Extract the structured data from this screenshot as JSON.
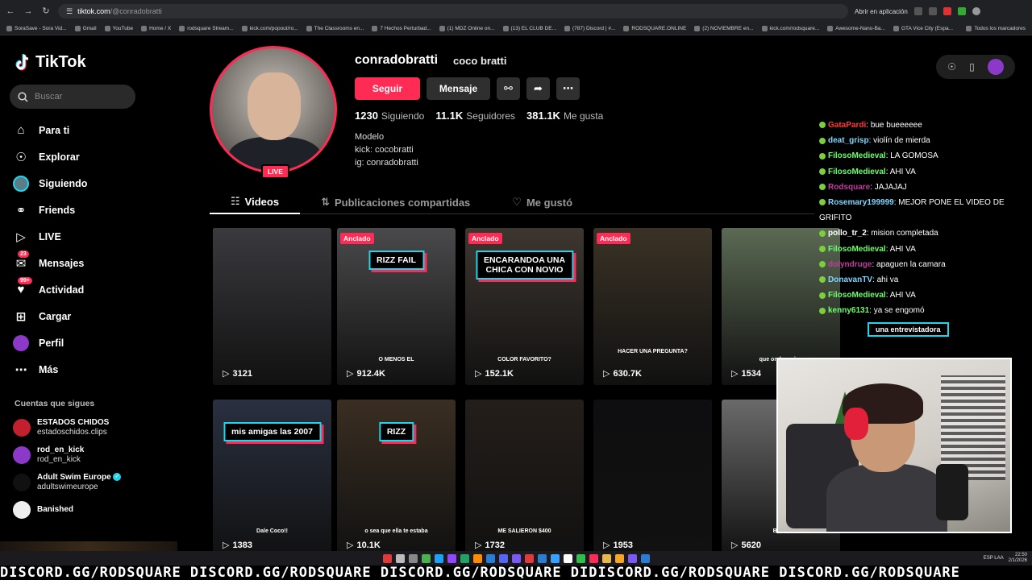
{
  "browser": {
    "url_host": "tiktok.com",
    "url_path": "/@conradobratti",
    "app_open_label": "Abrir en aplicación",
    "bookmarks": [
      "SoraSave - Sora Vid...",
      "Gmail",
      "YouTube",
      "Home / X",
      "rodsquare Stream...",
      "kick.com/popout/ro...",
      "The Classrooms en...",
      "7 Hechos Perturbad...",
      "(1) MDZ Online on...",
      "(13) EL CLUB DE...",
      "(787) Discord | #...",
      "RODSQUARE.ONLINE",
      "(2) NOVIEMBRE en...",
      "kick.com/rodsquare...",
      "Awesome-Nano-Ba...",
      "GTA Vice City (Espa..."
    ],
    "all_bookmarks": "Todos los marcadores"
  },
  "sidebar": {
    "logo": "TikTok",
    "search_placeholder": "Buscar",
    "items": [
      {
        "label": "Para ti",
        "icon": "home-icon"
      },
      {
        "label": "Explorar",
        "icon": "compass-icon"
      },
      {
        "label": "Siguiendo",
        "icon": "following-avatar-icon"
      },
      {
        "label": "Friends",
        "icon": "friends-icon"
      },
      {
        "label": "LIVE",
        "icon": "live-icon"
      },
      {
        "label": "Mensajes",
        "icon": "messages-icon",
        "badge": "23"
      },
      {
        "label": "Actividad",
        "icon": "activity-icon",
        "badge": "99+"
      },
      {
        "label": "Cargar",
        "icon": "upload-icon"
      },
      {
        "label": "Perfil",
        "icon": "profile-icon"
      },
      {
        "label": "Más",
        "icon": "more-icon"
      }
    ],
    "following_title": "Cuentas que sigues",
    "following": [
      {
        "name": "ESTADOS CHIDOS",
        "handle": "estadoschidos.clips",
        "color": "#c21f2f"
      },
      {
        "name": "rod_en_kick",
        "handle": "rod_en_kick",
        "color": "#8c39c9"
      },
      {
        "name": "Adult Swim Europe",
        "handle": "adultswimeurope",
        "color": "#111111",
        "verified": true
      },
      {
        "name": "Banished",
        "handle": "",
        "color": "#eeeeee"
      }
    ]
  },
  "profile": {
    "username": "conradobratti",
    "nickname": "coco bratti",
    "live_label": "LIVE",
    "follow_label": "Seguir",
    "message_label": "Mensaje",
    "stats": [
      {
        "value": "1230",
        "label": "Siguiendo"
      },
      {
        "value": "11.1K",
        "label": "Seguidores"
      },
      {
        "value": "381.1K",
        "label": "Me gusta"
      }
    ],
    "bio": [
      "Modelo",
      "kick: cocobratti",
      "ig: conradobratti"
    ]
  },
  "tabs": [
    {
      "label": "Videos",
      "icon": "grid-icon",
      "active": true
    },
    {
      "label": "Publicaciones compartidas",
      "icon": "repost-icon",
      "active": false
    },
    {
      "label": "Me gustó",
      "icon": "heart-icon",
      "active": false
    }
  ],
  "videos": [
    {
      "views": "",
      "badge": "LIVE",
      "caption": "",
      "sub": "",
      "bg": "#cbbfae"
    },
    {
      "views": "912.4K",
      "badge": "Anclado",
      "caption": "RIZZ FAIL",
      "sub": "O MENOS EL",
      "bg": "#4a4a4c"
    },
    {
      "views": "152.1K",
      "badge": "Anclado",
      "caption": "ENCARANDOA UNA\nCHICA CON NOVIO",
      "sub": "COLOR FAVORITO?",
      "bg": "#3e3630"
    },
    {
      "views": "630.7K",
      "badge": "Anclado",
      "caption": "",
      "sub": "HACER UNA PREGUNTA?",
      "bg": "#3a3226"
    },
    {
      "views": "1534",
      "badge": "",
      "caption": "",
      "sub": "que onda amigo",
      "bg": "#5b6a54"
    },
    {
      "views": "1383",
      "badge": "",
      "caption": "mis amigas las 2007",
      "sub": "Dale Coco!!",
      "bg": "#2a3040"
    },
    {
      "views": "10.1K",
      "badge": "",
      "caption": "RIZZ",
      "sub": "o sea que ella te estaba",
      "bg": "#3a2e22"
    },
    {
      "views": "1732",
      "badge": "",
      "caption": "",
      "sub": "ME SALIERON $400",
      "bg": "#241e1a"
    },
    {
      "views": "1953",
      "badge": "",
      "caption": "",
      "sub": "",
      "bg": "#0e0e10"
    },
    {
      "views": "5620",
      "badge": "",
      "caption": "",
      "sub": "BUEN",
      "bg": "#6a6a6a"
    },
    {
      "views": "3121",
      "badge": "",
      "caption": "",
      "sub": "",
      "bg": "#3a3a3e"
    }
  ],
  "chat": [
    {
      "user": "GataPardi",
      "msg": "bue bueeeeee",
      "color": "#ff3b3b"
    },
    {
      "user": "deat_grisp",
      "msg": "violín de mierda",
      "color": "#7fd6ff"
    },
    {
      "user": "FilosoMedieval",
      "msg": "LA GOMOSA",
      "color": "#6cff6c"
    },
    {
      "user": "FilosoMedieval",
      "msg": "AHI VA",
      "color": "#6cff6c"
    },
    {
      "user": "Rodsquare",
      "msg": "JAJAJAJ",
      "color": "#c23ba0"
    },
    {
      "user": "Rosemary199999",
      "msg": "MEJOR PONE EL VIDEO DE",
      "color": "#7fd6ff"
    },
    {
      "user": "",
      "msg": "GRIFITO",
      "color": "#ffffff"
    },
    {
      "user": "pollo_tr_2",
      "msg": "mision completada",
      "color": "#ffffff"
    },
    {
      "user": "FilosoMedieval",
      "msg": "AHI VA",
      "color": "#6cff6c"
    },
    {
      "user": "dolyndruge",
      "msg": "apaguen la camara",
      "color": "#c23ba0"
    },
    {
      "user": "DonavanTV",
      "msg": "ahi va",
      "color": "#7fd6ff"
    },
    {
      "user": "FilosoMedieval",
      "msg": "AHI VA",
      "color": "#6cff6c"
    },
    {
      "user": "kenny6131",
      "msg": "ya se engomó",
      "color": "#6cff6c"
    }
  ],
  "chat_bottom_caption": "una entrevistadora",
  "taskbar": {
    "lang": "ESP LAA",
    "time": "22:50",
    "date": "2/1/2026"
  },
  "marquee": "DISCORD.GG/RODSQUARE DISCORD.GG/RODSQUARE DISCORD.GG/RODSQUARE DIDISCORD.GG/RODSQUARE DISCORD.GG/RODSQUARE",
  "colors": {
    "accent": "#fe2c55",
    "cyan": "#20d5ec",
    "bg": "#000000"
  }
}
